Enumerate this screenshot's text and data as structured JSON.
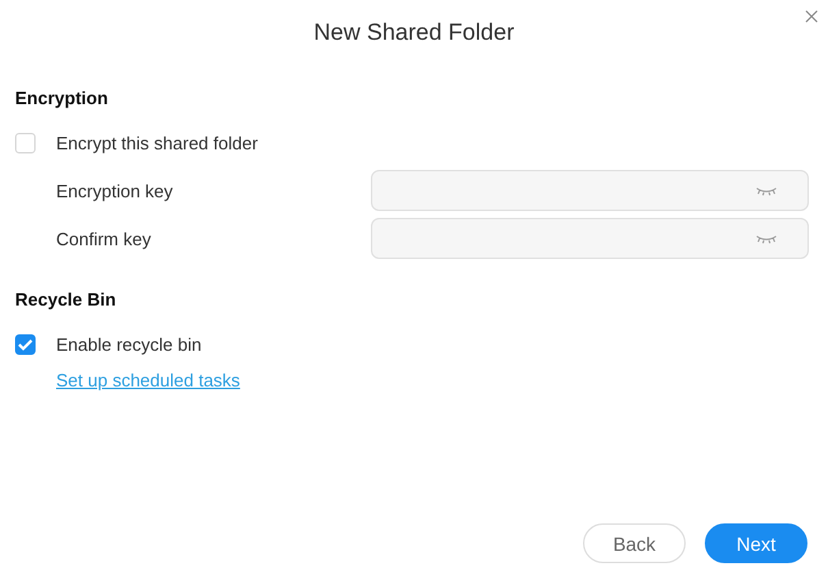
{
  "dialog": {
    "title": "New Shared Folder"
  },
  "sections": [
    {
      "heading": "Encryption",
      "checkbox": {
        "label": "Encrypt this shared folder",
        "checked": false
      },
      "fields": [
        {
          "label": "Encryption key",
          "disabled": true
        },
        {
          "label": "Confirm key",
          "disabled": true
        }
      ]
    },
    {
      "heading": "Recycle Bin",
      "checkbox": {
        "label": "Enable recycle bin",
        "checked": true
      },
      "link": "Set up scheduled tasks"
    }
  ],
  "buttons": [
    {
      "label": "Back",
      "kind": "secondary"
    },
    {
      "label": "Next",
      "kind": "primary"
    }
  ]
}
